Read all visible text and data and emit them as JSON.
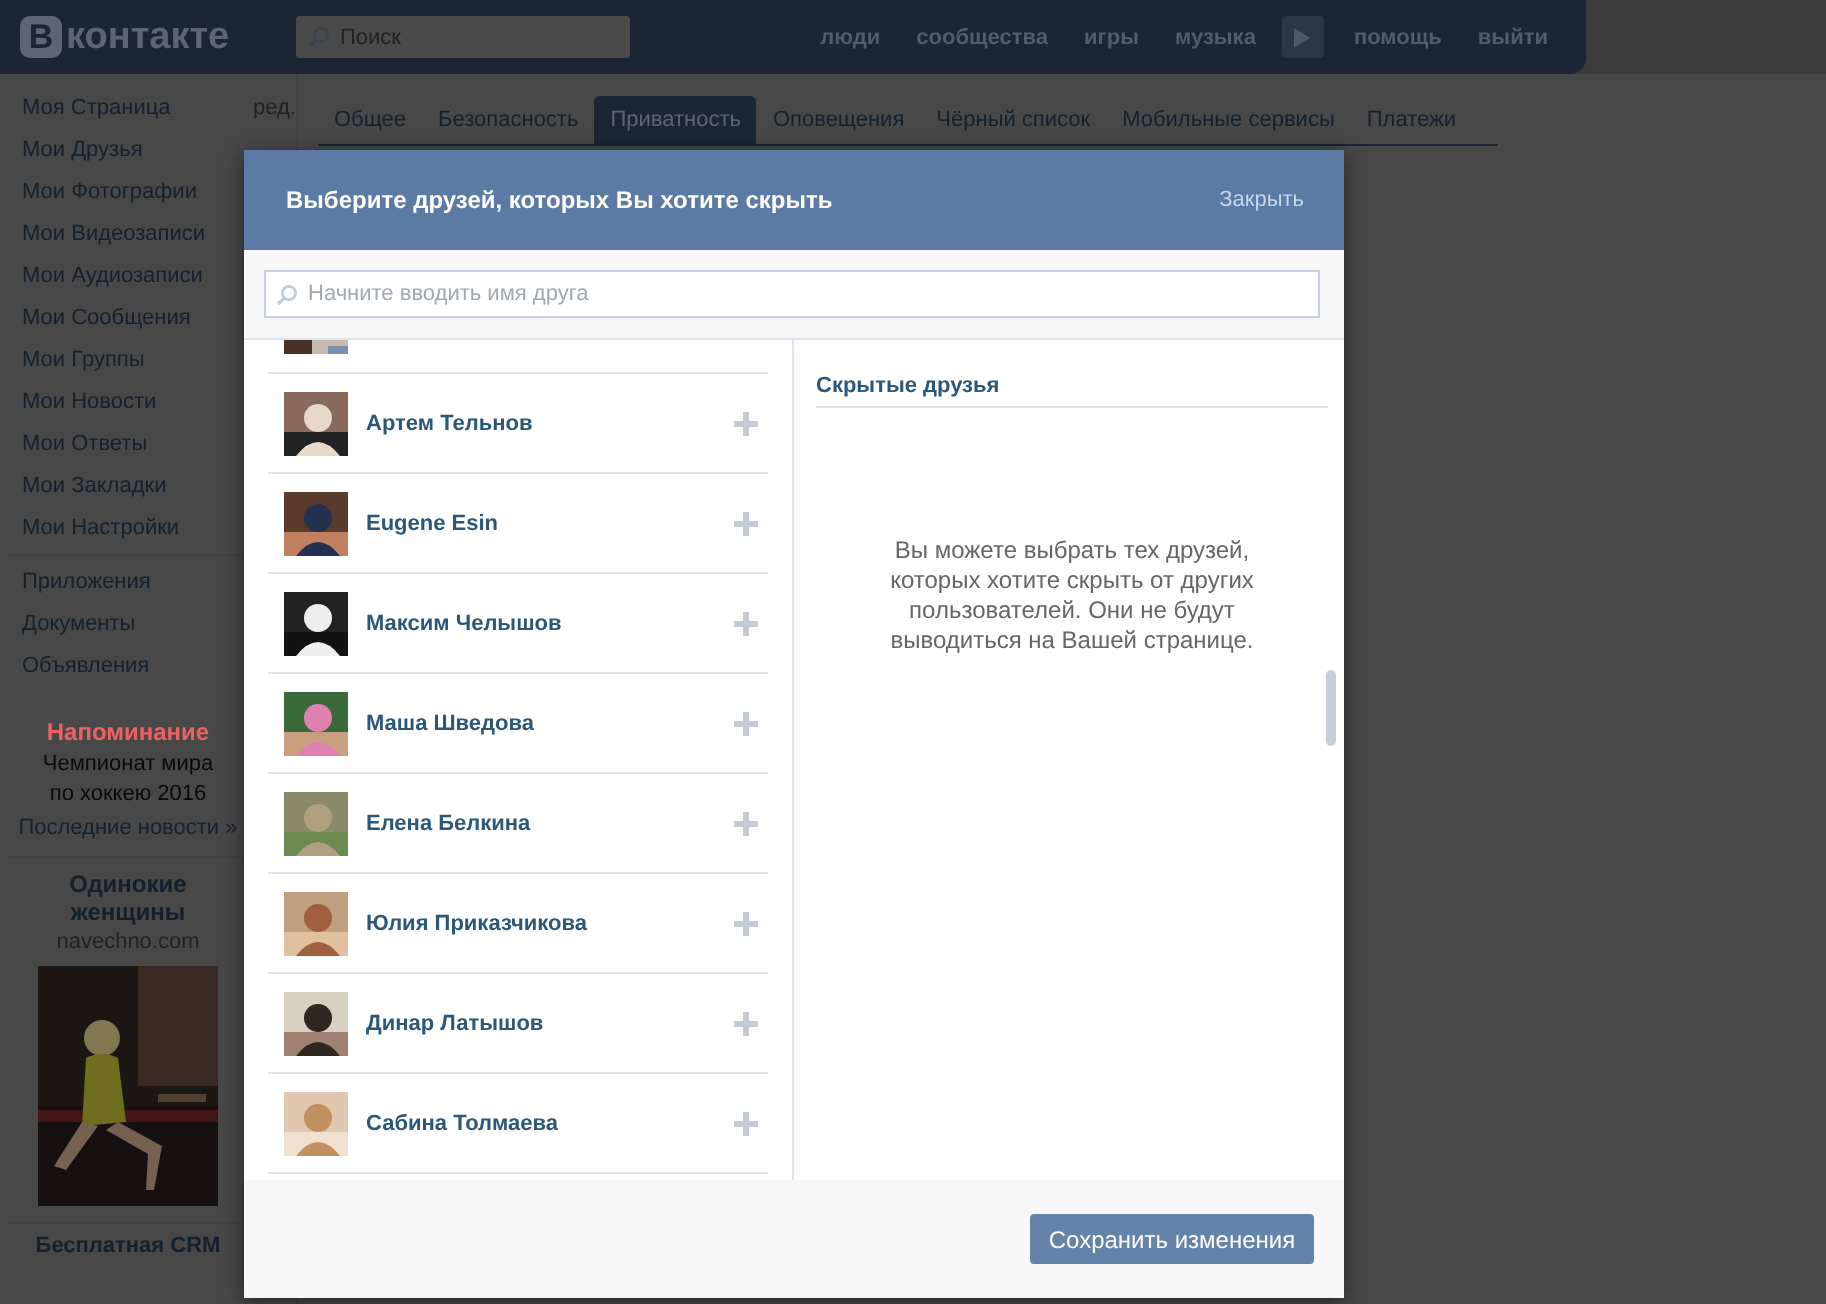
{
  "header": {
    "logo_badge": "В",
    "logo_text": "контакте",
    "search": {
      "placeholder": "Поиск"
    },
    "nav": [
      {
        "kind": "link",
        "label": "люди"
      },
      {
        "kind": "link",
        "label": "сообщества"
      },
      {
        "kind": "link",
        "label": "игры"
      },
      {
        "kind": "link",
        "label": "музыка"
      },
      {
        "kind": "play"
      },
      {
        "kind": "link",
        "label": "помощь"
      },
      {
        "kind": "link",
        "label": "выйти"
      }
    ]
  },
  "sidebar": {
    "edit_link": "ред.",
    "main_items": [
      "Моя Страница",
      "Мои Друзья",
      "Мои Фотографии",
      "Мои Видеозаписи",
      "Мои Аудиозаписи",
      "Мои Сообщения",
      "Мои Группы",
      "Мои Новости",
      "Мои Ответы",
      "Мои Закладки",
      "Мои Настройки"
    ],
    "extra_items": [
      "Приложения",
      "Документы",
      "Объявления"
    ],
    "reminder": {
      "title": "Напоминание",
      "text": "Чемпионат мира по хоккею 2016",
      "link": "Последние новости »"
    },
    "ad": {
      "title": "Одинокие женщины",
      "domain": "navechno.com"
    },
    "ad_2": {
      "title": "Бесплатная CRM"
    }
  },
  "tabs": [
    {
      "label": "Общее",
      "selected": false
    },
    {
      "label": "Безопасность",
      "selected": false
    },
    {
      "label": "Приватность",
      "selected": true
    },
    {
      "label": "Оповещения",
      "selected": false
    },
    {
      "label": "Чёрный список",
      "selected": false
    },
    {
      "label": "Мобильные сервисы",
      "selected": false
    },
    {
      "label": "Платежи",
      "selected": false
    }
  ],
  "dialog": {
    "title": "Выберите друзей, которых Вы хотите скрыть",
    "close": "Закрыть",
    "search": {
      "placeholder": "Начните вводить имя друга"
    },
    "friends": [
      {
        "name": "Артем Тельнов"
      },
      {
        "name": "Eugene Esin"
      },
      {
        "name": "Максим Челышов"
      },
      {
        "name": "Маша Шведова"
      },
      {
        "name": "Елена Белкина"
      },
      {
        "name": "Юлия Приказчикова"
      },
      {
        "name": "Динар Латышов"
      },
      {
        "name": "Сабина Толмаева"
      }
    ],
    "hidden_title": "Скрытые друзья",
    "hidden_hint": "Вы можете выбрать тех друзей, которых хотите скрыть от других пользователей. Они не будут выводиться на Вашей странице.",
    "save_button": "Сохранить изменения"
  }
}
